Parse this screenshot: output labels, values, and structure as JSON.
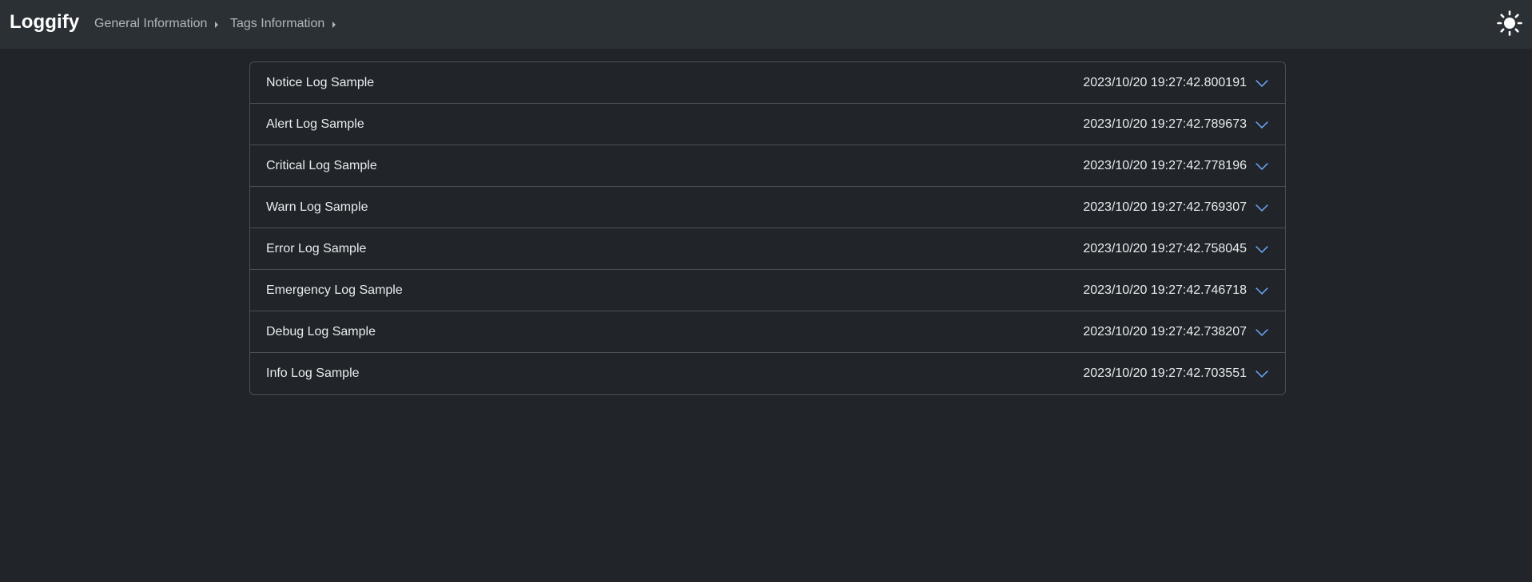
{
  "app": {
    "brand": "Loggify"
  },
  "nav": {
    "items": [
      {
        "label": "General Information"
      },
      {
        "label": "Tags Information"
      }
    ],
    "theme_icon": "sun-icon"
  },
  "logs": [
    {
      "title": "Notice Log Sample",
      "timestamp": "2023/10/20 19:27:42.800191"
    },
    {
      "title": "Alert Log Sample",
      "timestamp": "2023/10/20 19:27:42.789673"
    },
    {
      "title": "Critical Log Sample",
      "timestamp": "2023/10/20 19:27:42.778196"
    },
    {
      "title": "Warn Log Sample",
      "timestamp": "2023/10/20 19:27:42.769307"
    },
    {
      "title": "Error Log Sample",
      "timestamp": "2023/10/20 19:27:42.758045"
    },
    {
      "title": "Emergency Log Sample",
      "timestamp": "2023/10/20 19:27:42.746718"
    },
    {
      "title": "Debug Log Sample",
      "timestamp": "2023/10/20 19:27:42.738207"
    },
    {
      "title": "Info Log Sample",
      "timestamp": "2023/10/20 19:27:42.703551"
    }
  ],
  "colors": {
    "background": "#212529",
    "navbar": "#2b3035",
    "border": "#495057",
    "chevron": "#6ea8fe"
  }
}
